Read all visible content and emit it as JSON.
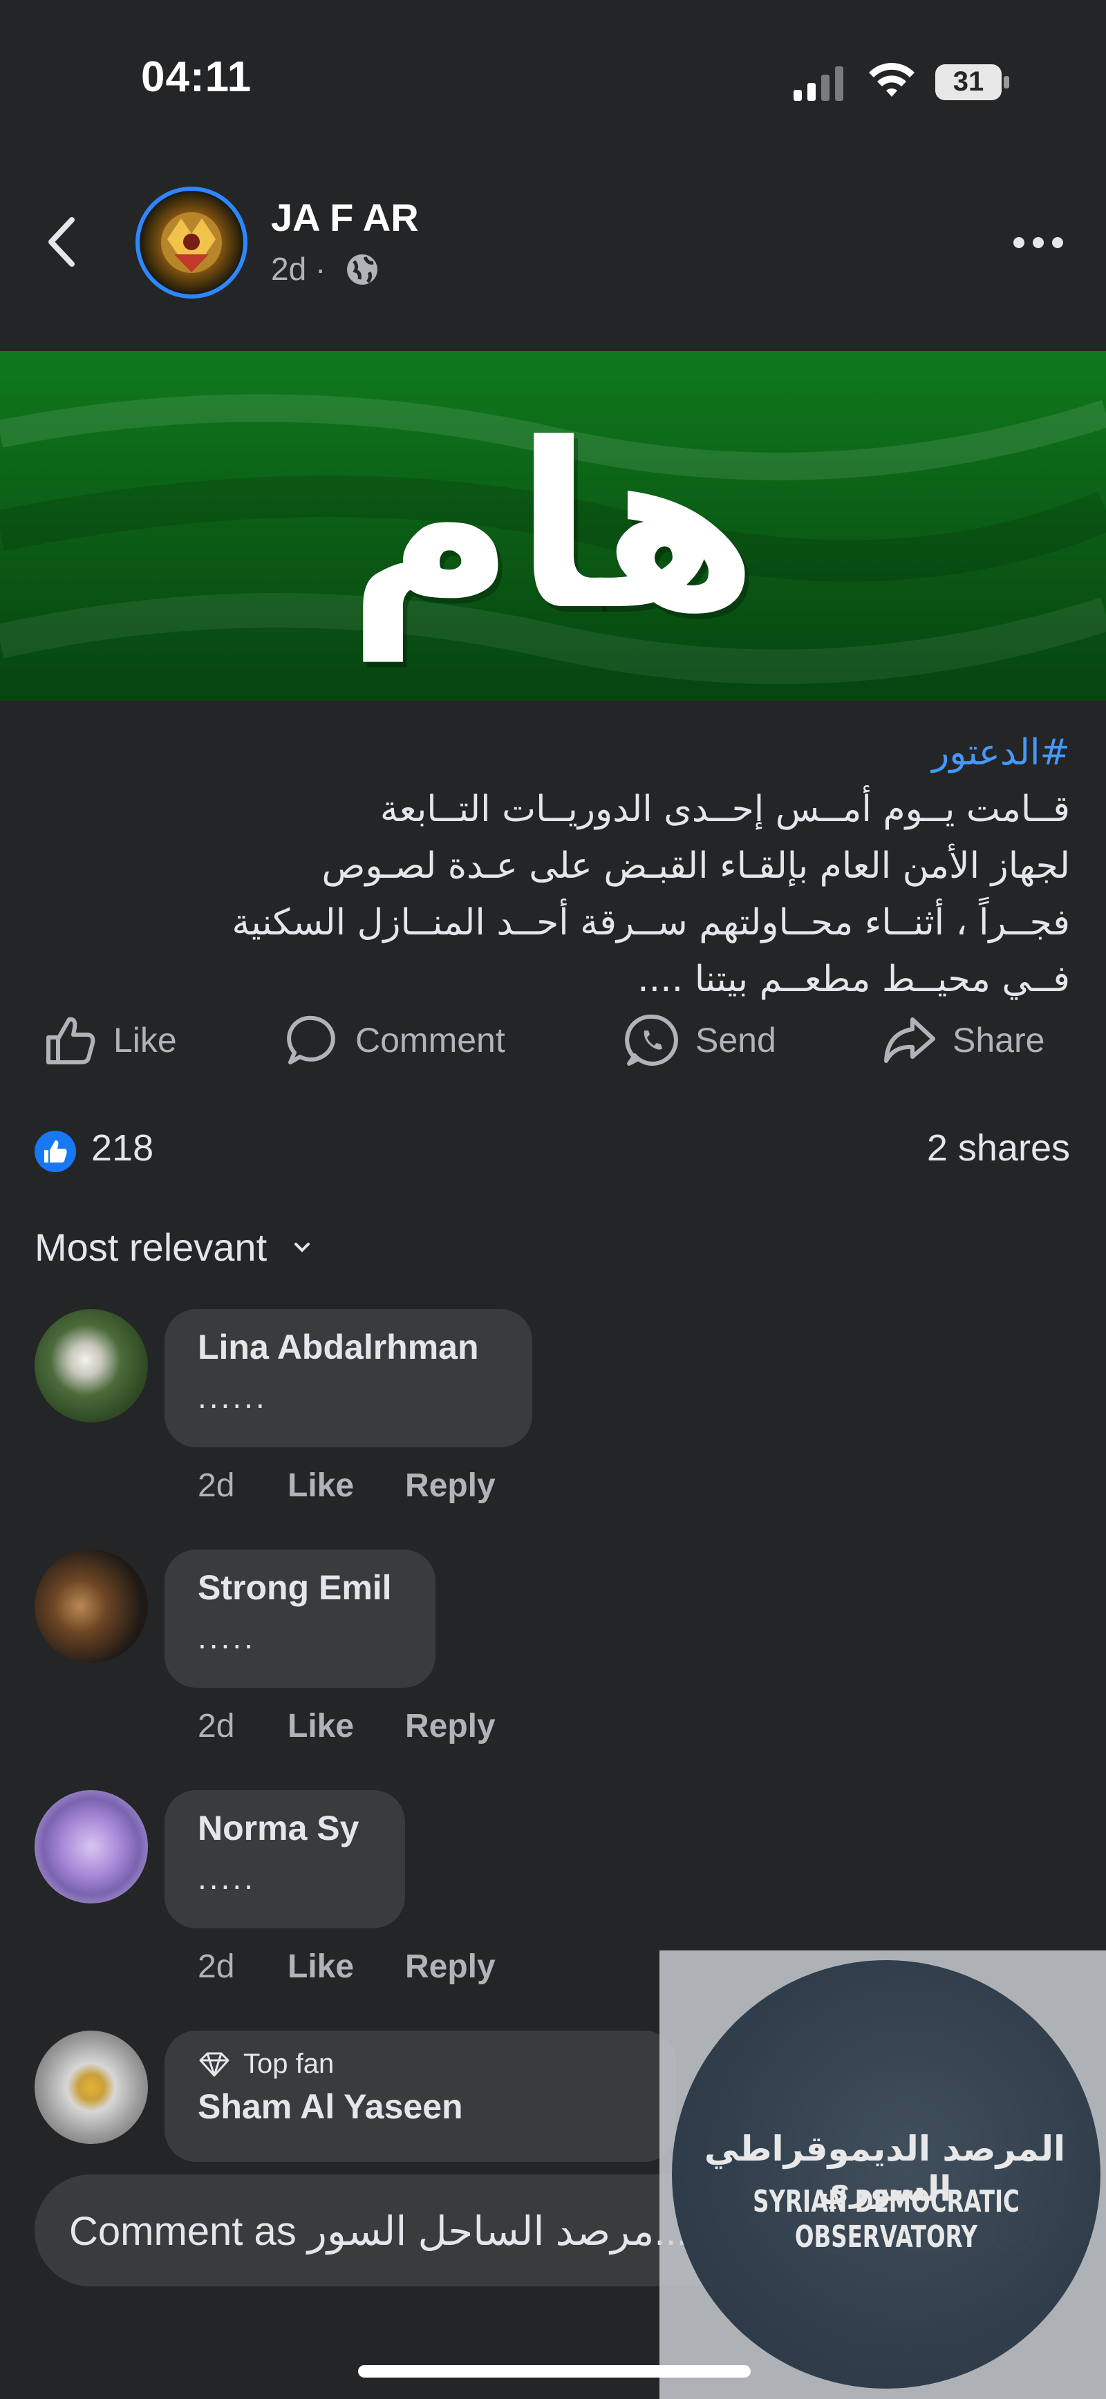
{
  "status_bar": {
    "time": "04:11",
    "battery": "31"
  },
  "post": {
    "author": "JA F AR",
    "time": "2d ·",
    "banner_text": "هام",
    "hashtag": "#الدعتور",
    "text_lines": [
      "قــامت يــوم أمــس إحــدى الدوريــات التــابعة",
      "لجهاز الأمن العام بإلقـاء القبـض على عـدة لصـوص",
      "فجــراً ، أثنــاء محــاولتهم ســرقة أحــد المنــازل السكنية",
      "فــي محيــط مطعــم بيتنا ...."
    ]
  },
  "actions": {
    "like": "Like",
    "comment": "Comment",
    "send": "Send",
    "share": "Share"
  },
  "reactions": {
    "count": "218",
    "shares": "2 shares"
  },
  "sort_label": "Most relevant",
  "comments": [
    {
      "name": "Lina Abdalrhman",
      "text": "......",
      "time": "2d",
      "like": "Like",
      "reply": "Reply"
    },
    {
      "name": "Strong Emil",
      "text": ".....",
      "time": "2d",
      "like": "Like",
      "reply": "Reply"
    },
    {
      "name": "Norma Sy",
      "text": ".....",
      "time": "2d",
      "like": "Like",
      "reply": "Reply"
    },
    {
      "badge": "Top fan",
      "name": "Sham Al Yaseen"
    }
  ],
  "comment_input": {
    "placeholder": "Comment as مرصد الساحل السور..."
  },
  "watermark": {
    "arabic": "المرصد الديموقراطي السوري",
    "english": "SYRIAN DEMOCRATIC OBSERVATORY"
  },
  "colors": {
    "background": "#242526",
    "bubble": "#3a3b3c",
    "link": "#4599ff",
    "like_blue": "#1877f2",
    "banner_green": "#0b5d15"
  }
}
